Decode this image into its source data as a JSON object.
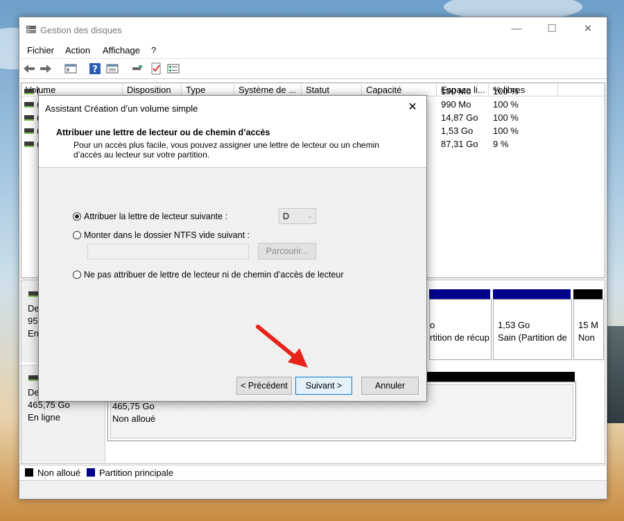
{
  "main_window": {
    "title": "Gestion des disques",
    "controls": {
      "minimize": "—",
      "maximize": "☐",
      "close": "✕"
    },
    "menu": [
      "Fichier",
      "Action",
      "Affichage",
      "?"
    ],
    "columns": [
      "Volume",
      "Disposition",
      "Type",
      "Système de ...",
      "Statut",
      "Capacité",
      "Espace li...",
      "% libres"
    ],
    "rows": [
      {
        "volume": "(",
        "free": "190 Mo",
        "pct": "100 %"
      },
      {
        "volume": "(",
        "free": "990 Mo",
        "pct": "100 %"
      },
      {
        "volume": "(",
        "free": "14,87 Go",
        "pct": "100 %"
      },
      {
        "volume": "(",
        "free": "1,53 Go",
        "pct": "100 %"
      },
      {
        "volume": "(",
        "free": "87,31 Go",
        "pct": "9 %"
      }
    ],
    "disk0": {
      "label": {
        "line1": "De",
        "line2": "95:",
        "line3": "En"
      },
      "partitions": [
        {
          "line1": "o",
          "line2": "rtition de récup"
        },
        {
          "line1": "1,53 Go",
          "line2": "Sain (Partition de"
        },
        {
          "line1": "15 M",
          "line2": "Non"
        }
      ]
    },
    "disk1": {
      "label": {
        "line1": "De",
        "line2": "465,75 Go",
        "line3": "En ligne"
      },
      "partition": {
        "line1": "465,75 Go",
        "line2": "Non alloué"
      }
    },
    "legend": [
      {
        "label": "Non alloué",
        "color": "#000000"
      },
      {
        "label": "Partition principale",
        "color": "#00008b"
      }
    ]
  },
  "dialog": {
    "title": "Assistant Création d’un volume simple",
    "close_label": "✕",
    "header_title": "Attribuer une lettre de lecteur ou de chemin d’accès",
    "header_desc": "Pour un accès plus facile, vous pouvez assigner une lettre de lecteur ou un chemin d’accès au lecteur sur votre partition.",
    "option_assign": "Attribuer la lettre de lecteur suivante :",
    "drive_letter": "D",
    "option_mount": "Monter dans le dossier NTFS vide suivant :",
    "folder_path": "",
    "browse_label": "Parcourir...",
    "option_none": "Ne pas attribuer de lettre de lecteur ni de chemin d’accès de lecteur",
    "selected_option": "assign",
    "buttons": {
      "back": "< Précédent",
      "next": "Suivant >",
      "cancel": "Annuler"
    }
  },
  "colors": {
    "primary_partition": "#00008b",
    "unallocated": "#000000",
    "focus": "#0078d7",
    "arrow": "#e8231b"
  }
}
